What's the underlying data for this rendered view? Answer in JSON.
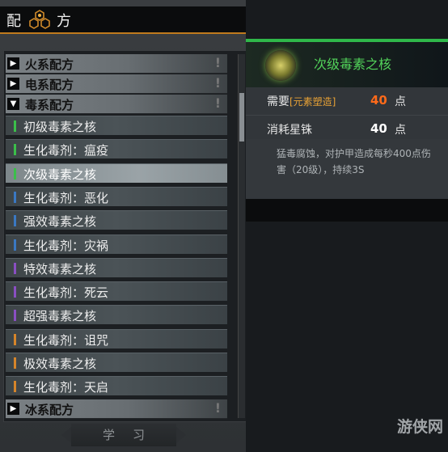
{
  "title": {
    "left": "配",
    "right": "方"
  },
  "categories": {
    "fire": "火系配方",
    "electric": "电系配方",
    "poison": "毒系配方",
    "ice": "冰系配方",
    "alert": "!"
  },
  "recipes": [
    {
      "label": "初级毒素之核",
      "color": "#3bbf4a"
    },
    {
      "label": "生化毒剂：瘟疫",
      "color": "#3bbf4a"
    },
    {
      "label": "次级毒素之核",
      "color": "#3bbf4a",
      "selected": true
    },
    {
      "label": "生化毒剂：恶化",
      "color": "#3a78c2"
    },
    {
      "label": "强效毒素之核",
      "color": "#3a78c2"
    },
    {
      "label": "生化毒剂：灾祸",
      "color": "#3a78c2"
    },
    {
      "label": "特效毒素之核",
      "color": "#8a4fc2"
    },
    {
      "label": "生化毒剂：死云",
      "color": "#8a4fc2"
    },
    {
      "label": "超强毒素之核",
      "color": "#8a4fc2"
    },
    {
      "label": "生化毒剂：诅咒",
      "color": "#d6852a"
    },
    {
      "label": "极效毒素之核",
      "color": "#d6852a"
    },
    {
      "label": "生化毒剂：天启",
      "color": "#d6852a"
    }
  ],
  "learn_button": "学习",
  "detail": {
    "title": "次级毒素之核",
    "icon": "poison-core-icon",
    "requirement": {
      "label": "需要",
      "tag": "[元素塑造]",
      "value": "40",
      "unit": "点",
      "value_color": "#ff6a1a"
    },
    "cost": {
      "label": "消耗星铢",
      "value": "40",
      "unit": "点",
      "value_color": "#ffffff"
    },
    "description": "猛毒腐蚀，对护甲造成每秒400点伤害（20级），持续3S"
  },
  "watermark": "游侠网"
}
